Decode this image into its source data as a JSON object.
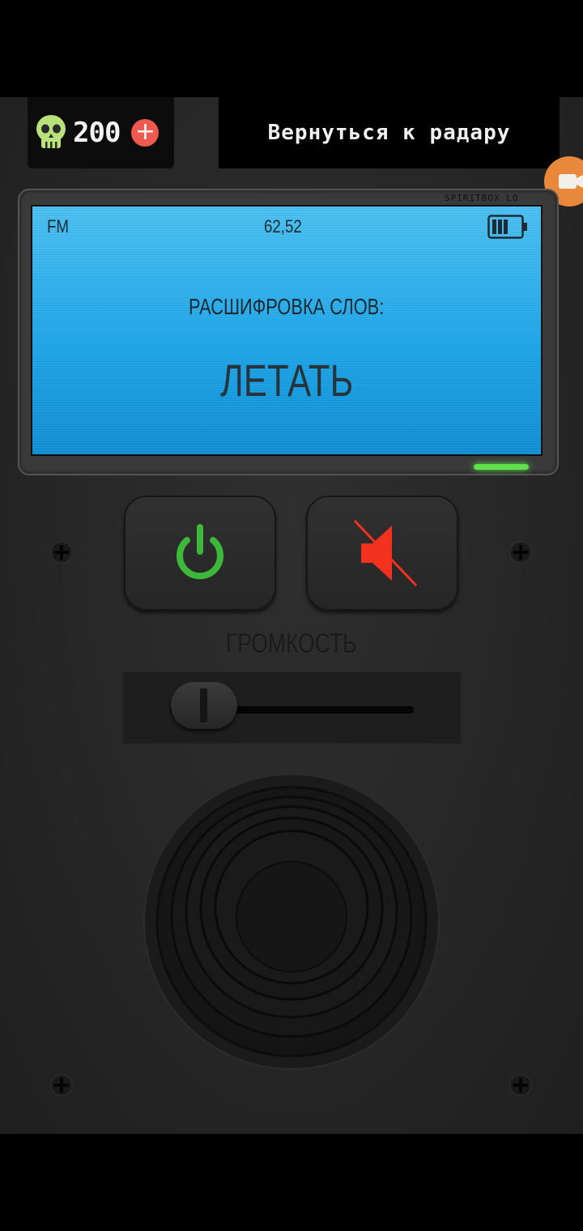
{
  "header": {
    "currency_value": "200",
    "add_label": "+",
    "back_button_label": "Вернуться к радару"
  },
  "device": {
    "brand": "SPIRITBOX LO",
    "screen": {
      "band": "FM",
      "frequency": "62,52",
      "title": "РАСШИФРОВКА СЛОВ:",
      "word": "ЛЕТАТЬ"
    },
    "volume_label": "ГРОМКОСТЬ",
    "volume_level": 0.1
  },
  "icons": [
    "skull-icon",
    "record-camera-icon",
    "battery-icon",
    "power-icon",
    "mute-icon",
    "screw-icon",
    "speaker-grille"
  ],
  "colors": {
    "lcd": "#1ca7ea",
    "power": "#3cb83a",
    "mute": "#f2321f",
    "led": "#5ee14a",
    "plus": "#ef5a4f",
    "record": "#e9883b"
  }
}
